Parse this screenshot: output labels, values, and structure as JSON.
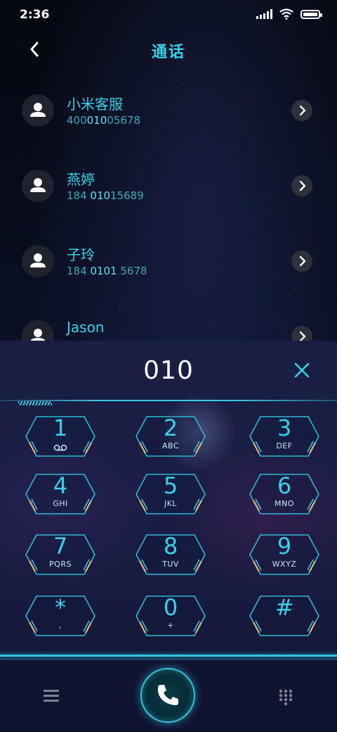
{
  "status": {
    "time": "2:36"
  },
  "header": {
    "title": "通话"
  },
  "contacts": [
    {
      "name": "小米客服",
      "num_pre": "400",
      "num_match": "010",
      "num_post": "05678"
    },
    {
      "name": "燕婷",
      "num_pre": "184 ",
      "num_match": "010",
      "num_post": "15689"
    },
    {
      "name": "子玲",
      "num_pre": "184 ",
      "num_match": "0101",
      "num_post": " 5678"
    },
    {
      "name": "Jason",
      "num_pre": "",
      "num_match": "",
      "num_post": ""
    }
  ],
  "dialer": {
    "input": "010",
    "keys": [
      {
        "digit": "1",
        "letters": "",
        "icon": "voicemail-icon"
      },
      {
        "digit": "2",
        "letters": "ABC"
      },
      {
        "digit": "3",
        "letters": "DEF"
      },
      {
        "digit": "4",
        "letters": "GHI"
      },
      {
        "digit": "5",
        "letters": "JKL"
      },
      {
        "digit": "6",
        "letters": "MNO"
      },
      {
        "digit": "7",
        "letters": "PQRS"
      },
      {
        "digit": "8",
        "letters": "TUV"
      },
      {
        "digit": "9",
        "letters": "WXYZ"
      },
      {
        "digit": "*",
        "letters": ","
      },
      {
        "digit": "0",
        "letters": "+"
      },
      {
        "digit": "#",
        "letters": ""
      }
    ]
  },
  "colors": {
    "accent": "#37d3e8",
    "panel": "#1a1d44",
    "background": "#05070f"
  }
}
